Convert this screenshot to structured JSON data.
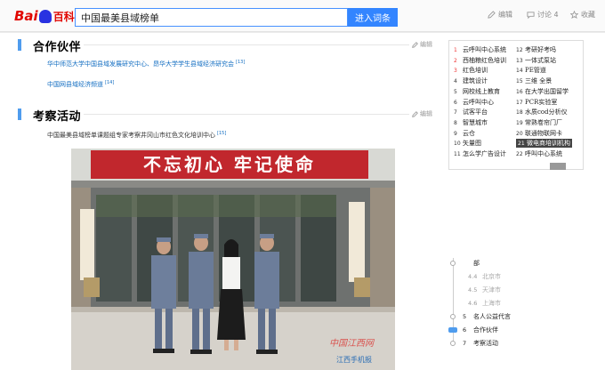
{
  "header": {
    "logo": {
      "bai": "Bai",
      "paw": "du",
      "ke": "百科"
    },
    "search_value": "中国最美县域榜单",
    "search_button": "进入词条",
    "actions": [
      {
        "label": "编辑",
        "icon": "pencil-icon"
      },
      {
        "label": "讨论 4",
        "icon": "discussion-icon"
      },
      {
        "label": "收藏",
        "icon": "star-icon"
      }
    ]
  },
  "sections": [
    {
      "title": "合作伙伴",
      "edit_label": "编辑",
      "paragraphs": [
        {
          "text": "华中师范大学中国县域发展研究中心、昂华大学学生县域经济研究会",
          "ref": "[13]"
        },
        {
          "text": "中国网县域经济频道",
          "ref": "[14]"
        }
      ]
    },
    {
      "title": "考察活动",
      "edit_label": "编辑",
      "paragraphs": [
        {
          "text": "中国最美县域榜单课题组专家考察井冈山市红色文化培训中心",
          "ref": "[15]"
        }
      ]
    }
  ],
  "photo": {
    "banner_text": "不忘初心 牢记使命",
    "side_sign": "井冈山市红色文化培训中心",
    "watermark_top": "中国江西网",
    "watermark_bottom": "江西手机报"
  },
  "hot_list": {
    "left": [
      {
        "num": "1",
        "text": "云呼叫中心系统"
      },
      {
        "num": "2",
        "text": "西柚粮红色培训"
      },
      {
        "num": "3",
        "text": "红色培训"
      },
      {
        "num": "4",
        "text": "建筑设计"
      },
      {
        "num": "5",
        "text": "网校线上教育"
      },
      {
        "num": "6",
        "text": "云呼叫中心"
      },
      {
        "num": "7",
        "text": "试客平台"
      },
      {
        "num": "8",
        "text": "智慧城市"
      },
      {
        "num": "9",
        "text": "云仓"
      },
      {
        "num": "10",
        "text": "矢量图"
      },
      {
        "num": "11",
        "text": "怎么学广告设计"
      }
    ],
    "right": [
      {
        "num": "12",
        "text": "考研好考吗"
      },
      {
        "num": "13",
        "text": "一体式泵站"
      },
      {
        "num": "14",
        "text": "PE管道"
      },
      {
        "num": "15",
        "text": "三维 全景"
      },
      {
        "num": "16",
        "text": "在大学出国留学"
      },
      {
        "num": "17",
        "text": "PCR实验室"
      },
      {
        "num": "18",
        "text": "水质cod分析仪"
      },
      {
        "num": "19",
        "text": "常熟卷帘门厂"
      },
      {
        "num": "20",
        "text": "联通物联网卡"
      },
      {
        "num": "21",
        "text": "微电商培训机构"
      },
      {
        "num": "22",
        "text": "呼叫中心系统"
      }
    ],
    "active_index": 9
  },
  "toc": {
    "items": [
      {
        "num": "",
        "text": "部",
        "level": 1
      },
      {
        "num": "4.4",
        "text": "北京市",
        "level": 2
      },
      {
        "num": "4.5",
        "text": "天津市",
        "level": 2
      },
      {
        "num": "4.6",
        "text": "上海市",
        "level": 2
      },
      {
        "num": "5",
        "text": "名人公益代言",
        "level": 1
      },
      {
        "num": "6",
        "text": "合作伙伴",
        "level": 1,
        "active": true
      },
      {
        "num": "7",
        "text": "考察活动",
        "level": 1
      }
    ]
  },
  "colors": {
    "accent": "#3385ff",
    "section_bar": "#4f9cee",
    "link": "#136ec2",
    "logo_red": "#e10601",
    "logo_blue": "#2932e1"
  }
}
